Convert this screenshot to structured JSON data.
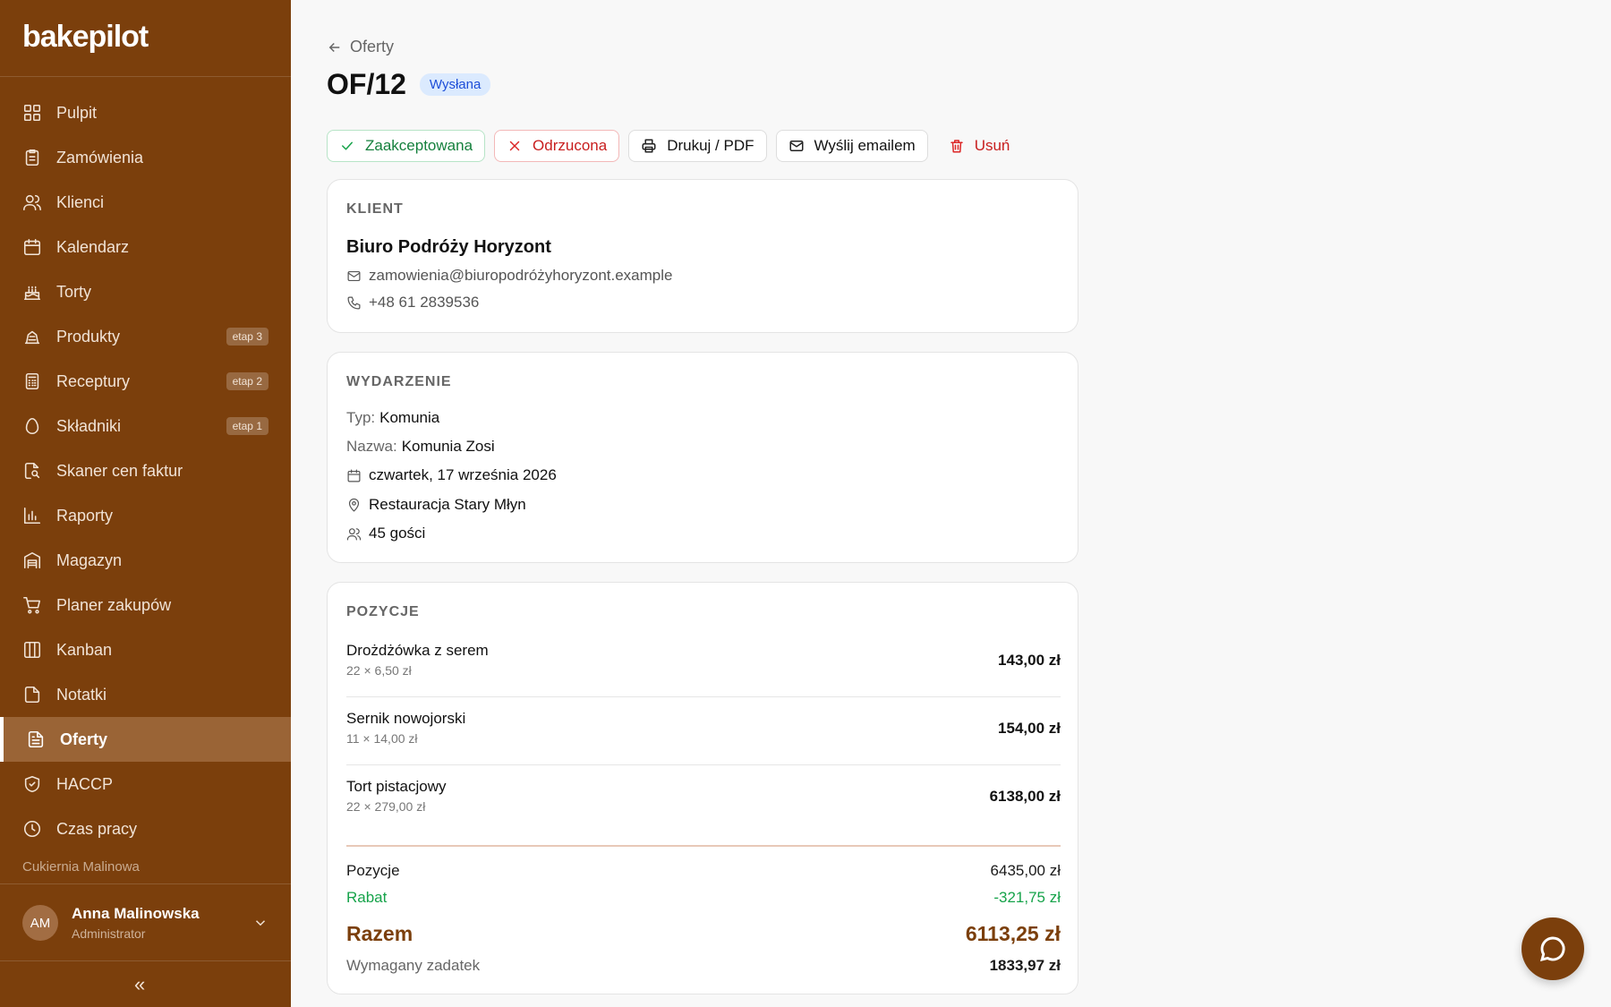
{
  "app": {
    "logo": "bakepilot",
    "company": "Cukiernia Malinowa"
  },
  "sidebar": {
    "items": [
      {
        "label": "Pulpit",
        "icon": "grid-icon",
        "badge": ""
      },
      {
        "label": "Zamówienia",
        "icon": "clipboard-icon",
        "badge": ""
      },
      {
        "label": "Klienci",
        "icon": "users-icon",
        "badge": ""
      },
      {
        "label": "Kalendarz",
        "icon": "calendar-icon",
        "badge": ""
      },
      {
        "label": "Torty",
        "icon": "cake-icon",
        "badge": ""
      },
      {
        "label": "Produkty",
        "icon": "croissant-icon",
        "badge": "etap 3"
      },
      {
        "label": "Receptury",
        "icon": "calculator-icon",
        "badge": "etap 2"
      },
      {
        "label": "Składniki",
        "icon": "egg-icon",
        "badge": "etap 1"
      },
      {
        "label": "Skaner cen faktur",
        "icon": "file-scan-icon",
        "badge": ""
      },
      {
        "label": "Raporty",
        "icon": "bar-chart-icon",
        "badge": ""
      },
      {
        "label": "Magazyn",
        "icon": "warehouse-icon",
        "badge": ""
      },
      {
        "label": "Planer zakupów",
        "icon": "cart-icon",
        "badge": ""
      },
      {
        "label": "Kanban",
        "icon": "columns-icon",
        "badge": ""
      },
      {
        "label": "Notatki",
        "icon": "note-icon",
        "badge": ""
      },
      {
        "label": "Oferty",
        "icon": "file-text-icon",
        "badge": ""
      },
      {
        "label": "HACCP",
        "icon": "shield-icon",
        "badge": ""
      },
      {
        "label": "Czas pracy",
        "icon": "clock-icon",
        "badge": ""
      }
    ],
    "active": "Oferty"
  },
  "user": {
    "initials": "AM",
    "name": "Anna Malinowska",
    "role": "Administrator"
  },
  "collapse_label": "«",
  "header": {
    "back_label": "Oferty",
    "title": "OF/12",
    "status": "Wysłana"
  },
  "actions": {
    "accept": "Zaakceptowana",
    "reject": "Odrzucona",
    "print": "Drukuj / PDF",
    "email": "Wyślij emailem",
    "delete": "Usuń"
  },
  "client": {
    "heading": "KLIENT",
    "name": "Biuro Podróży Horyzont",
    "email": "zamowienia@biuropodróżyhoryzont.example",
    "phone": "+48 61 2839536"
  },
  "event": {
    "heading": "WYDARZENIE",
    "type_label": "Typ:",
    "type": "Komunia",
    "name_label": "Nazwa:",
    "name": "Komunia Zosi",
    "date": "czwartek, 17 września 2026",
    "location": "Restauracja Stary Młyn",
    "guests": "45 gości"
  },
  "items": {
    "heading": "POZYCJE",
    "rows": [
      {
        "name": "Drożdżówka z serem",
        "qty": "22 × 6,50 zł",
        "total": "143,00 zł"
      },
      {
        "name": "Sernik nowojorski",
        "qty": "11 × 14,00 zł",
        "total": "154,00 zł"
      },
      {
        "name": "Tort pistacjowy",
        "qty": "22 × 279,00 zł",
        "total": "6138,00 zł"
      }
    ]
  },
  "summary": {
    "positions_label": "Pozycje",
    "positions": "6435,00 zł",
    "discount_label": "Rabat",
    "discount": "-321,75 zł",
    "total_label": "Razem",
    "total": "6113,25 zł",
    "deposit_label": "Wymagany zadatek",
    "deposit": "1833,97 zł"
  },
  "colors": {
    "brand": "#7b3f0c",
    "accept": "#16a34a",
    "reject": "#dc2626",
    "status_bg": "#dbeafe",
    "status_fg": "#1d4ed8"
  }
}
